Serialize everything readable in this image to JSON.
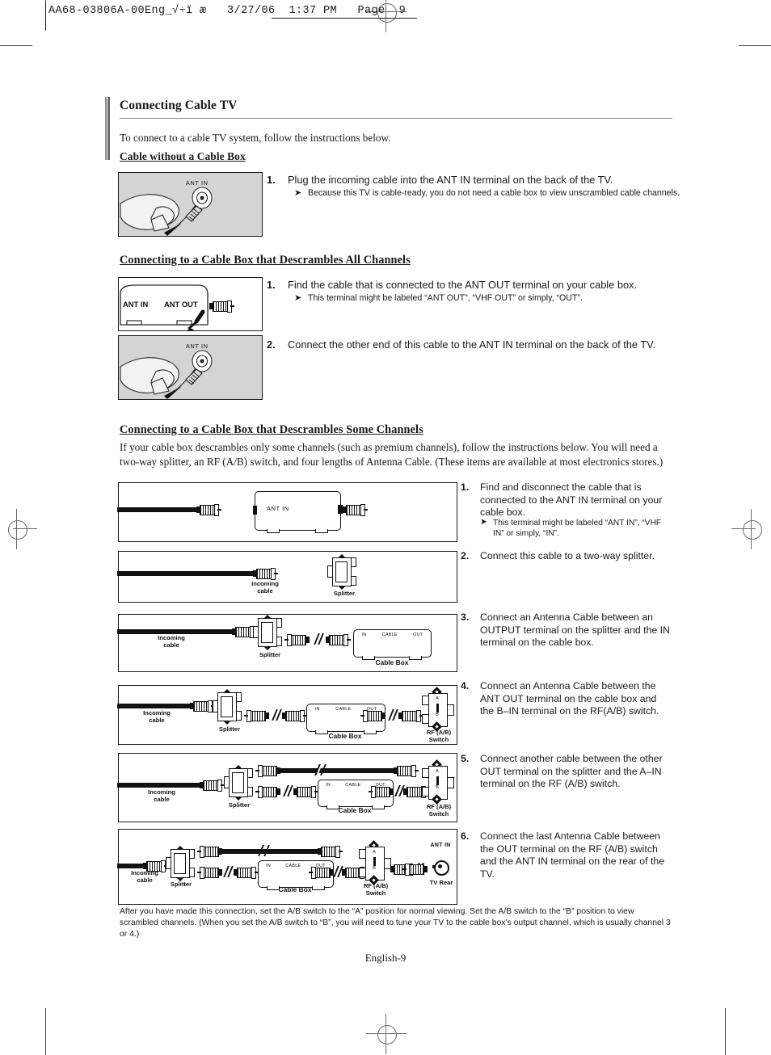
{
  "slug": {
    "text": "AA68-03806A-00Eng_√÷ï æ   3/27/06  1:37 PM   Page  9"
  },
  "section": {
    "title": "Connecting Cable TV",
    "intro": "To connect to a cable TV system, follow the instructions below."
  },
  "subheads": {
    "no_box": "Cable without a Cable Box",
    "all_channels": "Connecting to a Cable Box that Descrambles All Channels",
    "some_channels": "Connecting to a Cable Box that Descrambles Some Channels"
  },
  "some_channels_intro": "If your cable box descrambles only some channels (such as premium channels), follow the instructions below. You will need a two-way splitter, an RF (A/B) switch, and four lengths of Antenna Cable. (These items are available at most electronics stores.)",
  "steps_no_box": [
    {
      "num": "1.",
      "text": "Plug the incoming cable into the ANT IN terminal on the back of the TV.",
      "note": "Because this TV is cable-ready, you do not need a cable box to view unscrambled cable channels."
    }
  ],
  "steps_all_channels": [
    {
      "num": "1.",
      "text": "Find the cable that is connected to the ANT OUT terminal on your cable box.",
      "note": "This terminal might be labeled “ANT OUT”, “VHF OUT” or simply, “OUT”."
    },
    {
      "num": "2.",
      "text": "Connect the other end of this cable to the ANT IN terminal on the back of the TV.",
      "note": ""
    }
  ],
  "steps_some_channels": [
    {
      "num": "1.",
      "text": "Find and disconnect the cable that is connected to the ANT IN terminal on your cable box.",
      "note": "This terminal might be labeled “ANT IN”, “VHF IN” or simply, “IN”."
    },
    {
      "num": "2.",
      "text": "Connect this cable to a two-way splitter.",
      "note": ""
    },
    {
      "num": "3.",
      "text": "Connect an Antenna Cable between an OUTPUT terminal on the splitter and the IN terminal on the cable box.",
      "note": ""
    },
    {
      "num": "4.",
      "text": "Connect an Antenna Cable between the ANT OUT terminal on the cable box and the B–IN terminal on the RF(A/B) switch.",
      "note": ""
    },
    {
      "num": "5.",
      "text": "Connect another cable between the other OUT terminal on the splitter and the A–IN terminal on the RF (A/B) switch.",
      "note": ""
    },
    {
      "num": "6.",
      "text": "Connect the last Antenna Cable between the OUT terminal on the RF (A/B) switch and the ANT IN terminal on the rear of the TV.",
      "note": ""
    }
  ],
  "photos": {
    "photo1_label": "ANT IN",
    "photo2_ant_in": "ANT IN",
    "photo2_ant_out": "ANT OUT",
    "photo3_label": "ANT IN"
  },
  "diagram_labels": {
    "ant_in": "ANT IN",
    "incoming_cable": "Incoming\ncable",
    "incoming_cable_l1": "Incoming",
    "incoming_cable_l2": "cable",
    "splitter": "Splitter",
    "cable_box": "Cable Box",
    "rf_switch_l1": "RF (A/B)",
    "rf_switch_l2": "Switch",
    "tv_rear": "TV Rear",
    "tv_ant_in": "ANT IN",
    "port_in": "IN",
    "port_cable": "CABLE",
    "port_out": "OUT",
    "switch_a": "A",
    "switch_b": "B"
  },
  "footnote": "After you have made this connection, set the A/B switch to the “A” position for normal viewing. Set the A/B switch to the “B” position to view scrambled channels. (When you set the A/B switch to “B”, you will need to tune your TV to the cable box’s output channel, which is usually channel 3 or 4.)",
  "page_number": "English-9",
  "colors": {
    "ink": "#1a1a1a",
    "rule": "#8a8a8a",
    "photo_bg": "#d4d4d4",
    "mark": "#6a6a6a"
  }
}
